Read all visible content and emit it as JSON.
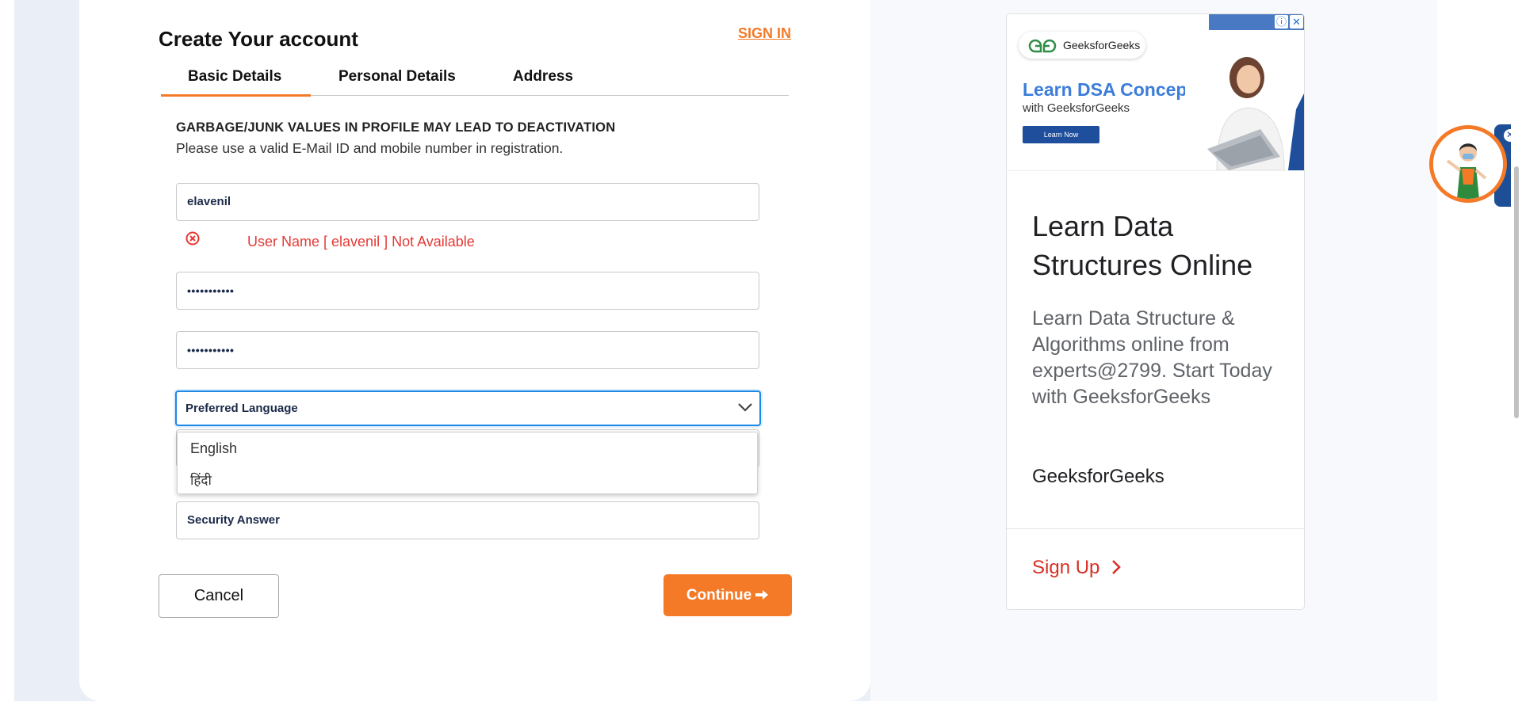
{
  "form": {
    "title": "Create Your account",
    "sign_in": "SIGN IN",
    "tabs": [
      {
        "label": "Basic Details",
        "active": true
      },
      {
        "label": "Personal Details"
      },
      {
        "label": "Address"
      }
    ],
    "warning": "GARBAGE/JUNK VALUES IN PROFILE MAY LEAD TO DEACTIVATION",
    "info": "Please use a valid E-Mail ID and mobile number in registration.",
    "username_value": "elavenil",
    "username_error": "User Name [ elavenil ] Not Available",
    "password_value": "•••••••••••",
    "confirm_password_value": "•••••••••••",
    "language_select": {
      "selected": "Preferred Language",
      "options": [
        "English",
        "हिंदी"
      ]
    },
    "security_answer_placeholder": "Security Answer",
    "cancel_label": "Cancel",
    "continue_label": "Continue",
    "accent_color": "#f47a28",
    "error_color": "#e53935"
  },
  "ad": {
    "banner_brand": "GeeksforGeeks",
    "banner_headline": "Learn DSA Concepts",
    "banner_sub": "with GeeksforGeeks",
    "banner_button": "Learn Now",
    "headline": "Learn Data Structures Online",
    "description": "Learn Data Structure & Algorithms online from experts@2799. Start Today with GeeksforGeeks",
    "brand": "GeeksforGeeks",
    "cta": "Sign Up",
    "cta_color": "#d93025"
  },
  "icons": [
    "error-circle-icon",
    "chevron-down-icon",
    "arrow-right-icon",
    "ad-info-icon",
    "ad-close-icon",
    "chevron-right-icon",
    "avatar-close-icon"
  ]
}
